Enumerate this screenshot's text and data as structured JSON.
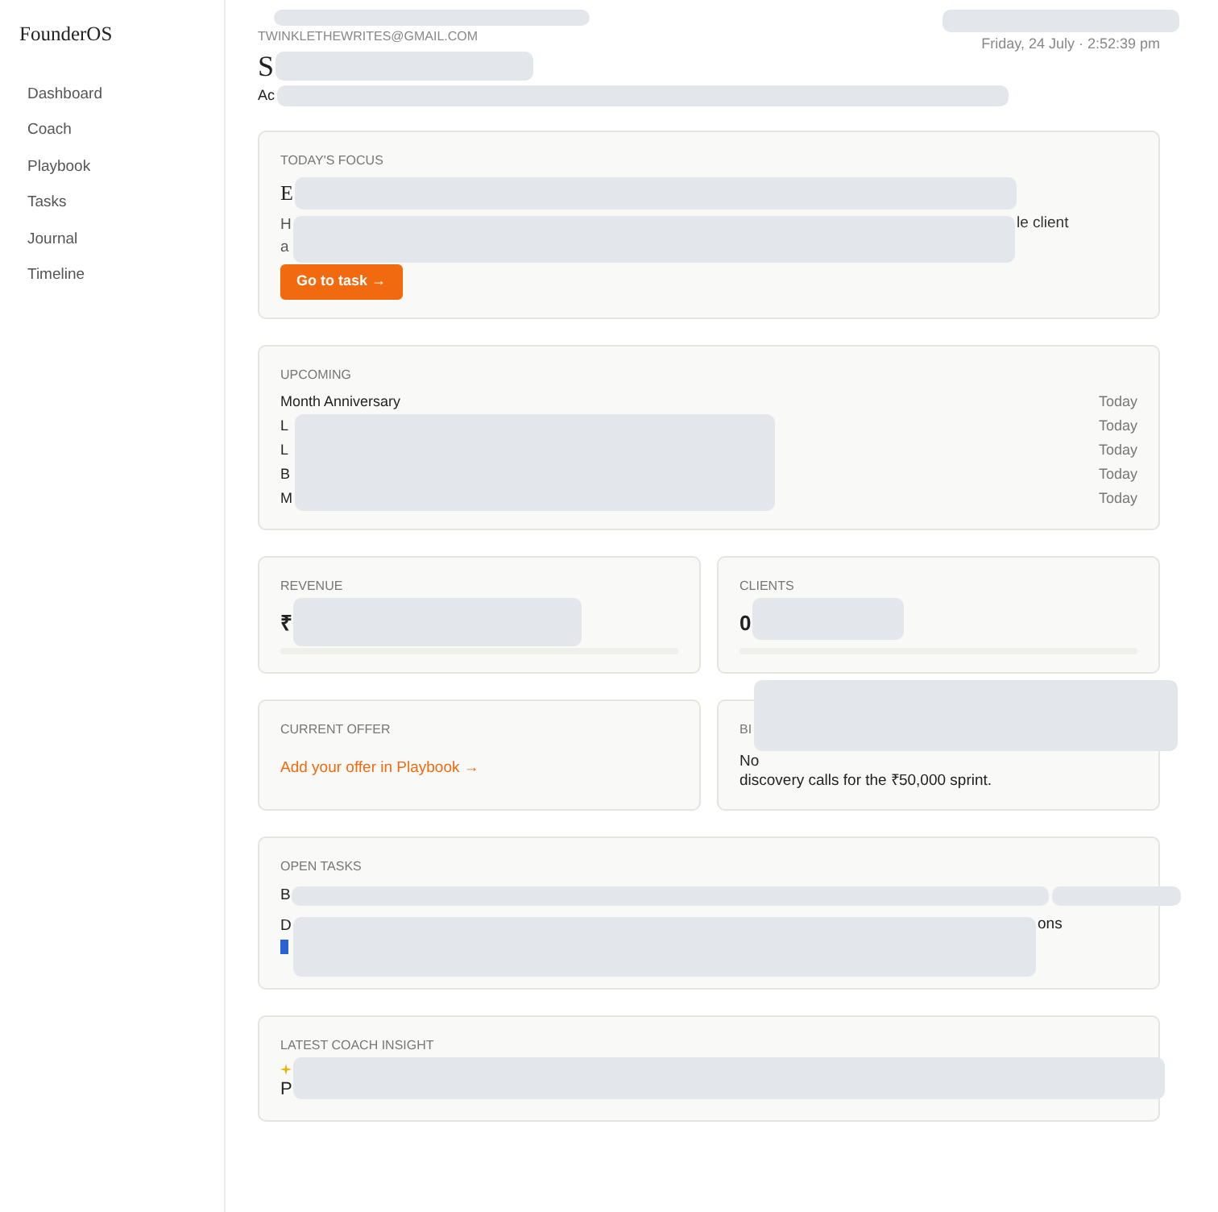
{
  "brand": "FounderOS",
  "nav": [
    {
      "label": "Dashboard"
    },
    {
      "label": "Coach"
    },
    {
      "label": "Playbook"
    },
    {
      "label": "Tasks"
    },
    {
      "label": "Journal"
    },
    {
      "label": "Timeline"
    }
  ],
  "header": {
    "email": "TWINKLETHEWRITES@GMAIL.COM",
    "title": "S",
    "subtitle": "Ac",
    "datetime": "Friday, 24 July · 2:52:39 pm"
  },
  "focus": {
    "label": "TODAY'S FOCUS",
    "title": "E",
    "lines": [
      {
        "text": "H",
        "tail": "le client"
      },
      {
        "text": "a"
      }
    ],
    "button": "Go to task →"
  },
  "upcoming": {
    "label": "UPCOMING",
    "items": [
      {
        "name": "Month Anniversary",
        "when": "Today"
      },
      {
        "name": "L",
        "when": "Today"
      },
      {
        "name": "L",
        "when": "Today"
      },
      {
        "name": "B",
        "when": "Today"
      },
      {
        "name": "M",
        "when": "Today"
      }
    ]
  },
  "stats": [
    {
      "label": "REVENUE",
      "value": "₹",
      "level": 0
    },
    {
      "label": "CLIENTS",
      "value": "0",
      "level": 0
    }
  ],
  "offer": {
    "label": "CURRENT OFFER",
    "link": "Add your offer in Playbook →"
  },
  "big": {
    "label": "BI",
    "lines": [
      "No",
      "discovery calls for the ₹50,000 sprint."
    ]
  },
  "tasks": {
    "label": "OPEN TASKS",
    "items": [
      {
        "text": "B",
        "highlight": false
      },
      {
        "text": "D",
        "tail": "ons",
        "highlight": true
      }
    ]
  },
  "insight": {
    "label": "LATEST COACH INSIGHT",
    "lines": [
      "P"
    ]
  }
}
